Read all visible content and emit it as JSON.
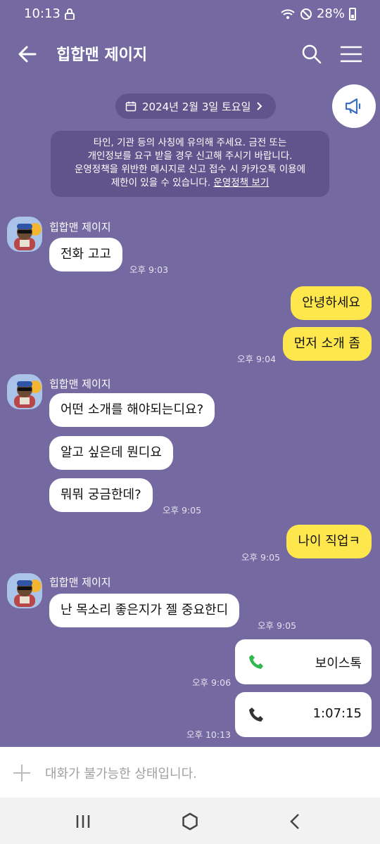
{
  "status_bar": {
    "time": "10:13",
    "battery": "28%"
  },
  "header": {
    "title": "힙합맨 제이지"
  },
  "date_pill": {
    "label": "2024년 2월 3일 토요일"
  },
  "notice": {
    "lines": [
      "타인, 기관 등의 사칭에 유의해 주세요. 금전 또는",
      "개인정보를 요구 받을 경우 신고해 주시기 바랍니다.",
      "운영정책을 위반한 메시지로 신고 접수 시 카카오톡 이용에"
    ],
    "last_line": "제한이 있을 수 있습니다.",
    "link": "운영정책 보기"
  },
  "messages": {
    "g1": {
      "sender": "힙합맨 제이지",
      "m1": "전화 고고",
      "time": "오후 9:03"
    },
    "o1": {
      "m1": "안녕하세요",
      "m2": "먼저 소개 좀",
      "time": "오후 9:04"
    },
    "g2": {
      "sender": "힙합맨 제이지",
      "m1": "어떤 소개를 해야되는디요?",
      "m2": "알고 싶은데 뭔디요",
      "m3": "뭐뭐 궁금한데?",
      "time": "오후 9:05"
    },
    "o2": {
      "m1": "나이 직업ㅋ",
      "time": "오후 9:05"
    },
    "g3": {
      "sender": "힙합맨 제이지",
      "m1": "난 목소리 좋은지가 젤 중요한디",
      "time": "오후 9:05"
    },
    "call1": {
      "label": "보이스톡",
      "time": "오후 9:06"
    },
    "call2": {
      "label": "1:07:15",
      "time": "오후 10:13"
    }
  },
  "input": {
    "placeholder": "대화가 불가능한 상태입니다."
  },
  "colors": {
    "background": "#7569a2",
    "outgoing": "#fde74c",
    "incoming": "#ffffff",
    "call_green": "#2fb84e"
  },
  "icons": [
    "lock-icon",
    "wifi-icon",
    "mute-icon",
    "battery-icon",
    "back-arrow-icon",
    "search-icon",
    "menu-icon",
    "calendar-icon",
    "chevron-right-icon",
    "megaphone-icon",
    "phone-icon",
    "plus-icon",
    "recent-apps-icon",
    "home-icon",
    "back-nav-icon"
  ]
}
